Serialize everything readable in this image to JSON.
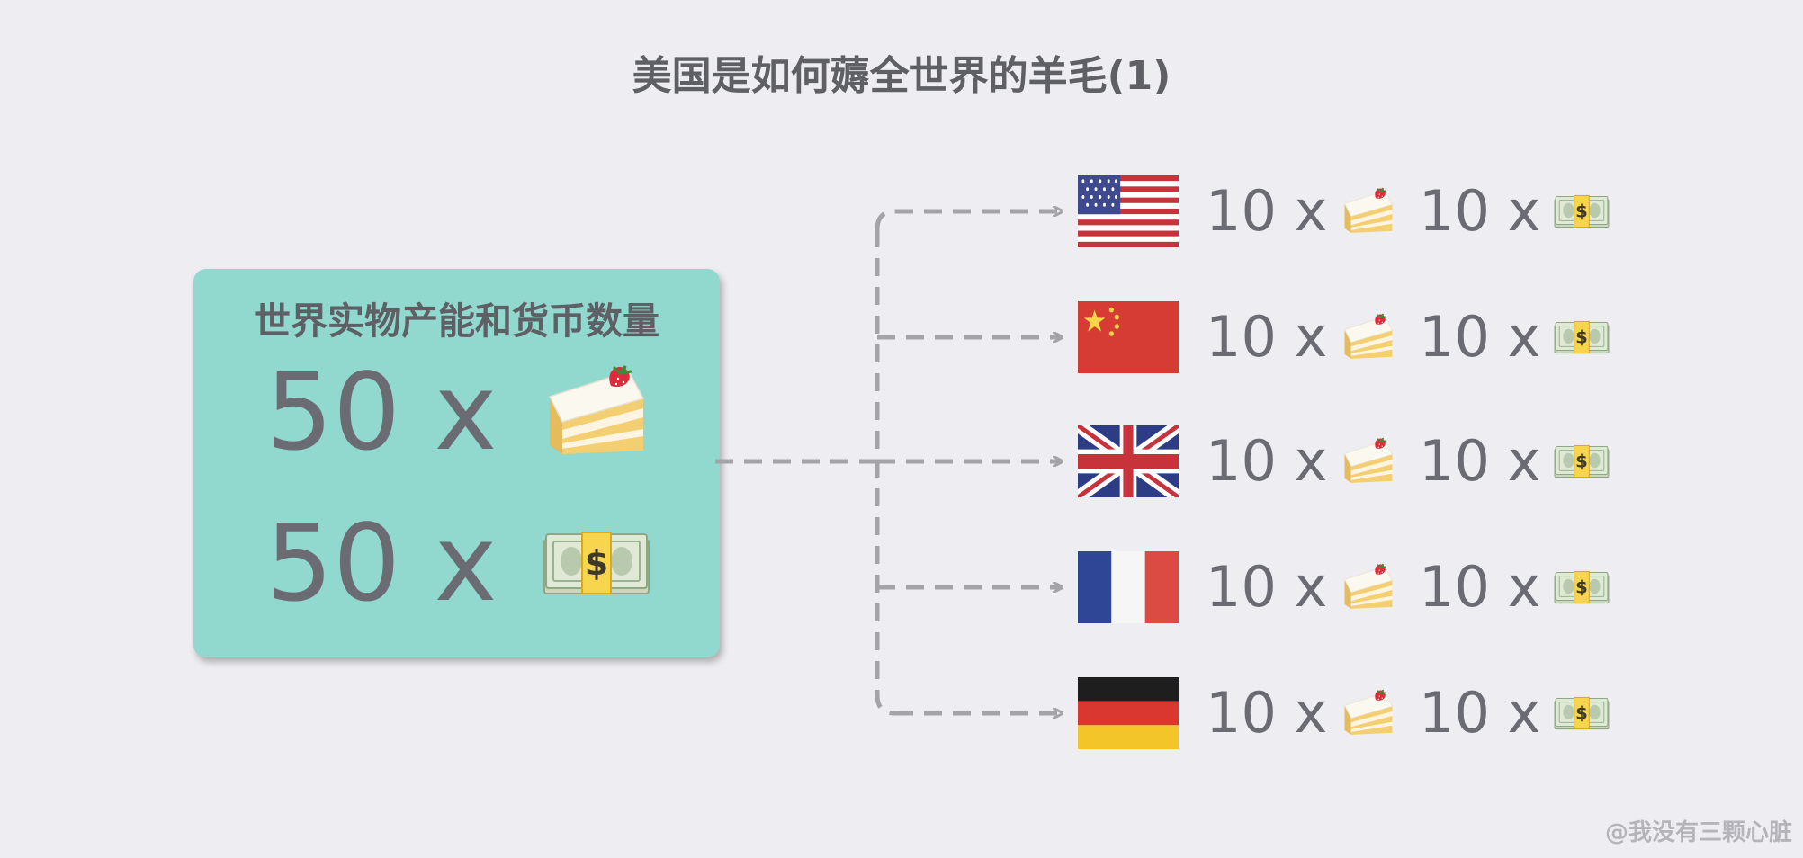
{
  "title": "美国是如何薅全世界的羊毛(1)",
  "world_box": {
    "title": "世界实物产能和货币数量",
    "cake_qty": "50 x",
    "money_qty": "50 x",
    "cake_icon": "cake-slice-icon",
    "money_icon": "money-bundle-icon",
    "color": "#91d8ce"
  },
  "countries": [
    {
      "flag": "us-flag-icon",
      "cake_qty": "10 x",
      "money_qty": "10 x"
    },
    {
      "flag": "china-flag-icon",
      "cake_qty": "10 x",
      "money_qty": "10 x"
    },
    {
      "flag": "uk-flag-icon",
      "cake_qty": "10 x",
      "money_qty": "10 x"
    },
    {
      "flag": "france-flag-icon",
      "cake_qty": "10 x",
      "money_qty": "10 x"
    },
    {
      "flag": "germany-flag-icon",
      "cake_qty": "10 x",
      "money_qty": "10 x"
    }
  ],
  "connector_color": "#a3a3a8",
  "watermark": "@我没有三颗心脏"
}
